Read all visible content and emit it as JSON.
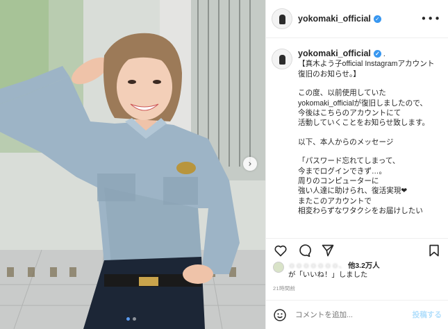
{
  "post": {
    "photo": {
      "alt_icons": [
        "next-arrow-icon"
      ],
      "carousel_count": 2,
      "carousel_active": 0
    },
    "header": {
      "username": "yokomaki_official",
      "more_label": "•••"
    },
    "caption": {
      "username": "yokomaki_official",
      "suffix": ".",
      "lines": [
        "【真木よう子official Instagramアカウント復旧のお知らせ。】",
        "",
        "この度、以前使用していた",
        "yokomaki_officialが復旧しましたので、",
        "今後はこちらのアカウントにて",
        "活動していくことをお知らせ致します。",
        "",
        "以下、本人からのメッセージ",
        "",
        "「パスワード忘れてしまって、",
        "今までログインできず…。",
        "周りのコンピューターに",
        "強い人達に助けられ、復活実現❤",
        "またこのアカウントで",
        "相変わらずなワタクシをお届けしたい"
      ]
    },
    "likes": {
      "blurred_name": "ｏｏｏｏｏｏｏ、",
      "others": "他3.2万人",
      "suffix": "が「いいね！」しました"
    },
    "time": "21時間前",
    "comment": {
      "placeholder": "コメントを追加...",
      "post_label": "投稿する"
    },
    "colors": {
      "verified": "#3897f0",
      "post_button_disabled": "#b2dffc",
      "carousel_dot_active": "#5a9bf0"
    }
  }
}
